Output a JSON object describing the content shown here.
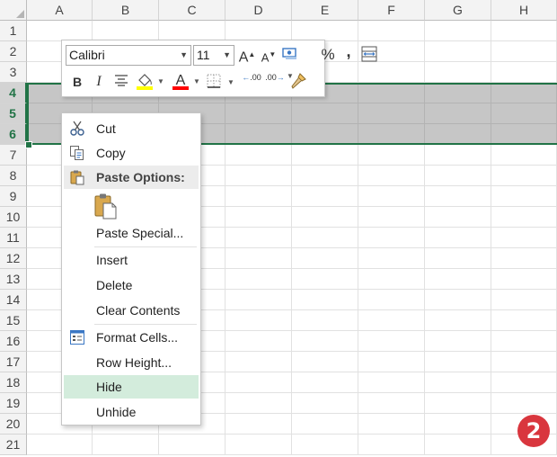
{
  "columns": [
    "A",
    "B",
    "C",
    "D",
    "E",
    "F",
    "G",
    "H"
  ],
  "rows": [
    "1",
    "2",
    "3",
    "4",
    "5",
    "6",
    "7",
    "8",
    "9",
    "10",
    "11",
    "12",
    "13",
    "14",
    "15",
    "16",
    "17",
    "18",
    "19",
    "20",
    "21"
  ],
  "selected_rows": [
    "4",
    "5",
    "6"
  ],
  "mini_toolbar": {
    "font_name": "Calibri",
    "font_size": "11",
    "grow_font": "A",
    "shrink_font": "A",
    "percent": "%",
    "comma": ",",
    "bold": "B",
    "italic": "I",
    "font_color_letter": "A",
    "increase_decimal": ".00",
    "decrease_decimal": ".00",
    "fill_color": "#ffff00",
    "font_color": "#ff0000"
  },
  "context_menu": {
    "cut": "Cut",
    "copy": "Copy",
    "paste_options": "Paste Options:",
    "paste_special": "Paste Special...",
    "insert": "Insert",
    "delete": "Delete",
    "clear_contents": "Clear Contents",
    "format_cells": "Format Cells...",
    "row_height": "Row Height...",
    "hide": "Hide",
    "unhide": "Unhide",
    "highlighted_item": "Hide"
  },
  "step_badge": "2",
  "colors": {
    "accent": "#217346",
    "selection_fill": "#c6c6c6",
    "highlight": "#d3ecdc",
    "badge": "#d9363e"
  }
}
